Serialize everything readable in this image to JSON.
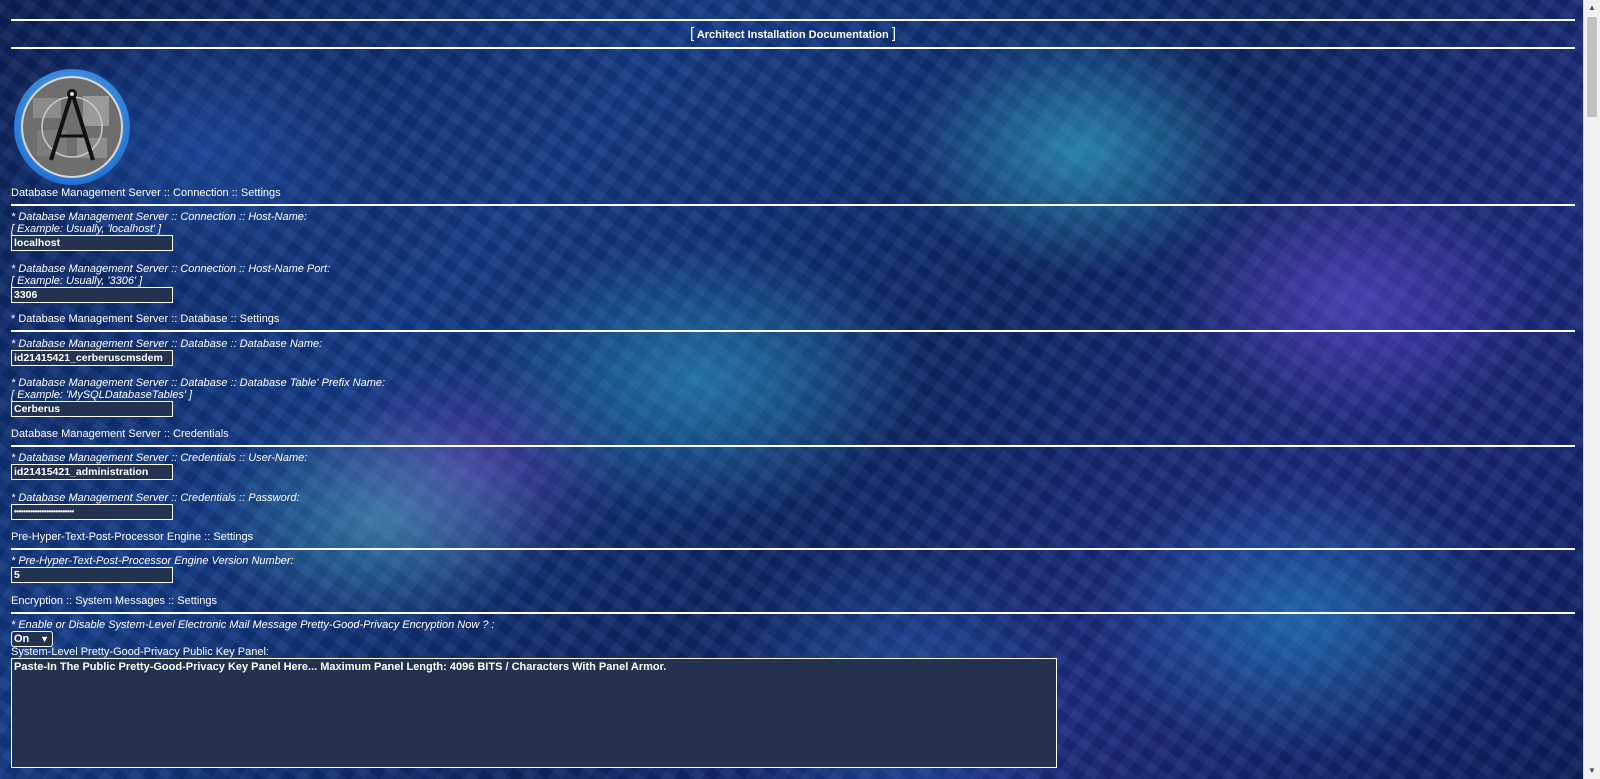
{
  "header": {
    "bracket_left": "[",
    "title": "Architect Installation Documentation",
    "bracket_right": "]"
  },
  "sections": {
    "connection": {
      "heading": "Database Management Server :: Connection :: Settings",
      "host": {
        "label": "* Database Management Server :: Connection :: Host-Name:",
        "example": "[ Example: Usually, 'localhost' ]",
        "value": "localhost"
      },
      "port": {
        "label": "* Database Management Server :: Connection :: Host-Name Port:",
        "example": "[ Example: Usually, '3306' ]",
        "value": "3306"
      }
    },
    "database": {
      "heading": "* Database Management Server :: Database :: Settings",
      "name": {
        "label": "* Database Management Server :: Database :: Database Name:",
        "value": "id21415421_cerberuscmsdem"
      },
      "prefix": {
        "label": "* Database Management Server :: Database :: Database Table' Prefix Name:",
        "example": "[ Example: 'MySQLDatabaseTables' ]",
        "value": "Cerberus"
      }
    },
    "credentials": {
      "heading": "Database Management Server :: Credentials",
      "user": {
        "label": "* Database Management Server :: Credentials :: User-Name:",
        "value": "id21415421_administration"
      },
      "password": {
        "label": "* Database Management Server :: Credentials :: Password:",
        "value": "••••••••••••••••••••••••••"
      }
    },
    "php": {
      "heading": "Pre-Hyper-Text-Post-Processor Engine :: Settings",
      "version": {
        "label": "* Pre-Hyper-Text-Post-Processor Engine Version Number:",
        "value": "5"
      }
    },
    "encryption": {
      "heading": "Encryption :: System Messages :: Settings",
      "toggle": {
        "label": "* Enable or Disable System-Level Electronic Mail Message Pretty-Good-Privacy Encryption Now ? :",
        "value": "On"
      },
      "key_panel": {
        "label": "System-Level Pretty-Good-Privacy Public Key Panel:",
        "placeholder": "Paste-In The Public Pretty-Good-Privacy Key Panel Here... Maximum Panel Length: 4096 BITS / Characters With Panel Armor."
      }
    }
  },
  "icons": {
    "logo": "architect-compass-logo",
    "scroll_up": "scroll-up-arrow-icon",
    "scroll_down": "scroll-down-arrow-icon",
    "select_chevron": "chevron-down-icon"
  }
}
